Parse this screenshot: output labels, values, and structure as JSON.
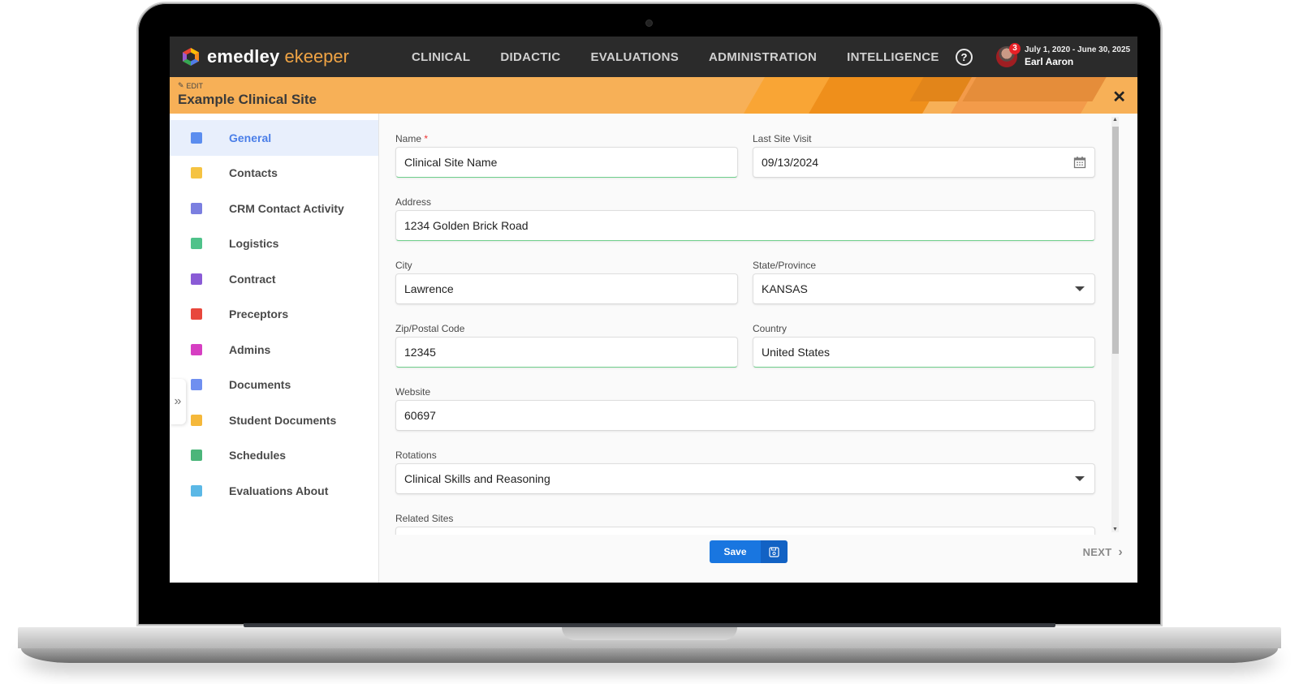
{
  "app": {
    "brand_primary": "emedley",
    "brand_secondary": "ekeeper",
    "nav": [
      "CLINICAL",
      "DIDACTIC",
      "EVALUATIONS",
      "ADMINISTRATION",
      "INTELLIGENCE"
    ],
    "help_icon": "?",
    "notification_count": "3",
    "date_range": "July 1, 2020 - June 30, 2025",
    "user_name": "Earl Aaron"
  },
  "header": {
    "mode_label": "EDIT",
    "title": "Example Clinical Site",
    "close_icon": "✕"
  },
  "sidebar": {
    "expand_icon": "»",
    "items": [
      {
        "label": "General",
        "icon": "id-card-icon",
        "color": "#5b8def",
        "active": true
      },
      {
        "label": "Contacts",
        "icon": "contact-book-icon",
        "color": "#f5c342"
      },
      {
        "label": "CRM Contact Activity",
        "icon": "mail-open-icon",
        "color": "#7b7fe0"
      },
      {
        "label": "Logistics",
        "icon": "clipboard-icon",
        "color": "#4fc28a"
      },
      {
        "label": "Contract",
        "icon": "contract-sign-icon",
        "color": "#8a5bd6"
      },
      {
        "label": "Preceptors",
        "icon": "preceptor-icon",
        "color": "#e8473c"
      },
      {
        "label": "Admins",
        "icon": "admins-group-icon",
        "color": "#d63fc2"
      },
      {
        "label": "Documents",
        "icon": "document-icon",
        "color": "#6f8ff0"
      },
      {
        "label": "Student Documents",
        "icon": "student-document-icon",
        "color": "#f5b83a"
      },
      {
        "label": "Schedules",
        "icon": "calendar-icon",
        "color": "#4bb57a"
      },
      {
        "label": "Evaluations About",
        "icon": "evaluation-check-icon",
        "color": "#5bb8e6"
      }
    ]
  },
  "form": {
    "name": {
      "label": "Name",
      "required_mark": "*",
      "value": "Clinical Site Name"
    },
    "last_site_visit": {
      "label": "Last Site Visit",
      "value": "09/13/2024"
    },
    "address": {
      "label": "Address",
      "value": "1234 Golden Brick Road"
    },
    "city": {
      "label": "City",
      "value": "Lawrence"
    },
    "state": {
      "label": "State/Province",
      "value": "KANSAS"
    },
    "zip": {
      "label": "Zip/Postal Code",
      "value": "12345"
    },
    "country": {
      "label": "Country",
      "value": "United States"
    },
    "website": {
      "label": "Website",
      "value": "60697"
    },
    "rotations": {
      "label": "Rotations",
      "value": "Clinical Skills and Reasoning"
    },
    "related_sites": {
      "label": "Related Sites",
      "value": ""
    }
  },
  "footer": {
    "save_label": "Save",
    "next_label": "NEXT",
    "next_icon": "›"
  },
  "colors": {
    "topbar": "#2b2b2b",
    "accent_orange": "#f7b057",
    "primary_blue": "#1976e0"
  }
}
